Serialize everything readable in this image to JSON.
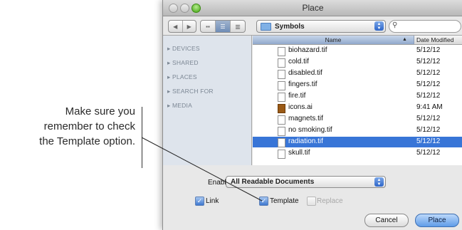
{
  "callout": {
    "lines": [
      "Make sure you",
      "remember to check",
      "the Template option."
    ]
  },
  "dialog": {
    "title": "Place",
    "toolbar": {
      "back_icon": "back-arrow-icon",
      "forward_icon": "forward-arrow-icon",
      "view_modes": [
        "icon-view-icon",
        "list-view-icon",
        "column-view-icon"
      ],
      "selected_view": "list-view-icon",
      "location": "Symbols",
      "search_placeholder": ""
    },
    "sidebar": [
      "DEVICES",
      "SHARED",
      "PLACES",
      "SEARCH FOR",
      "MEDIA"
    ],
    "columns": {
      "name": "Name",
      "date": "Date Modified"
    },
    "files": [
      {
        "name": "biohazard.tif",
        "date": "5/12/12",
        "selected": false,
        "icon": "tif-file-icon"
      },
      {
        "name": "cold.tif",
        "date": "5/12/12",
        "selected": false,
        "icon": "tif-file-icon"
      },
      {
        "name": "disabled.tif",
        "date": "5/12/12",
        "selected": false,
        "icon": "tif-file-icon"
      },
      {
        "name": "fingers.tif",
        "date": "5/12/12",
        "selected": false,
        "icon": "tif-file-icon"
      },
      {
        "name": "fire.tif",
        "date": "5/12/12",
        "selected": false,
        "icon": "tif-file-icon"
      },
      {
        "name": "icons.ai",
        "date": "9:41 AM",
        "selected": false,
        "icon": "ai-file-icon"
      },
      {
        "name": "magnets.tif",
        "date": "5/12/12",
        "selected": false,
        "icon": "tif-file-icon"
      },
      {
        "name": "no smoking.tif",
        "date": "5/12/12",
        "selected": false,
        "icon": "tif-file-icon"
      },
      {
        "name": "radiation.tif",
        "date": "5/12/12",
        "selected": true,
        "icon": "tif-file-icon"
      },
      {
        "name": "skull.tif",
        "date": "5/12/12",
        "selected": false,
        "icon": "tif-file-icon"
      }
    ],
    "enable": {
      "label": "Enable:",
      "value": "All Readable Documents"
    },
    "options": [
      {
        "label": "Link",
        "checked": true,
        "enabled": true
      },
      {
        "label": "Template",
        "checked": true,
        "enabled": true
      },
      {
        "label": "Replace",
        "checked": false,
        "enabled": false
      }
    ],
    "buttons": {
      "cancel": "Cancel",
      "place": "Place"
    },
    "colors": {
      "selection": "#3875d7",
      "sidebar": "#dee4ec",
      "default_button": "#5f9ce8"
    }
  }
}
